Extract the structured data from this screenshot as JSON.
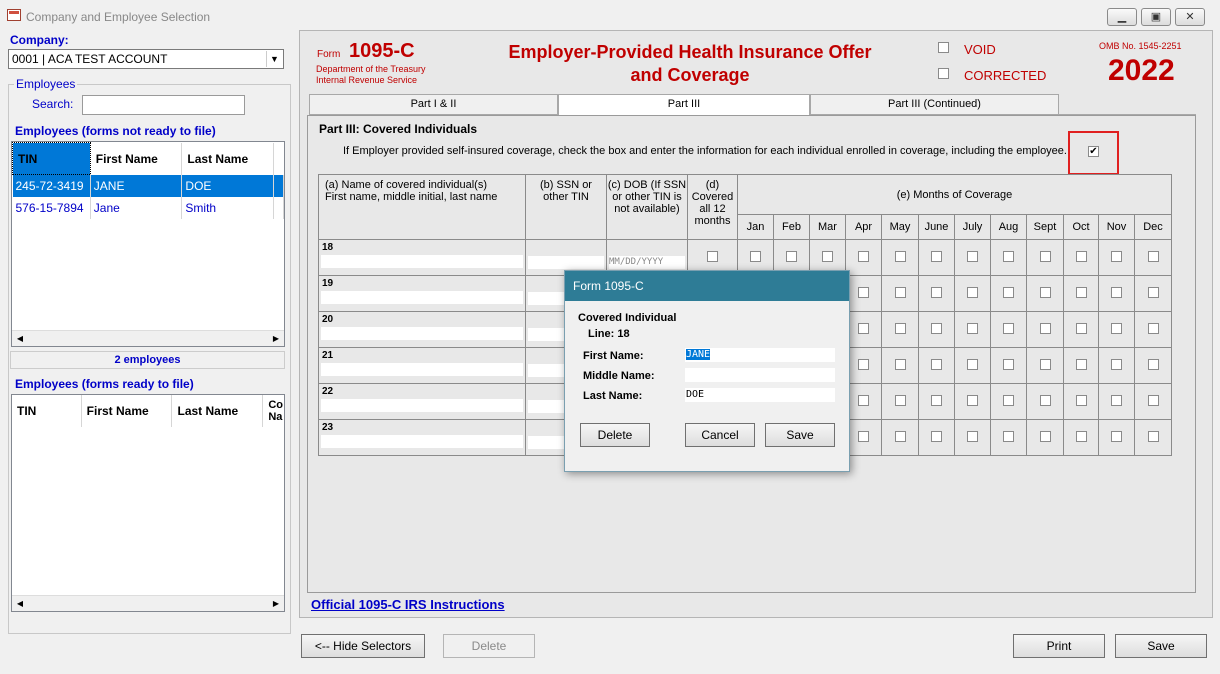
{
  "window": {
    "title": "Company and Employee Selection"
  },
  "left": {
    "company_label": "Company:",
    "company_value": "0001 | ACA TEST ACCOUNT",
    "employees_group": "Employees",
    "search_label": "Search:",
    "search_value": "",
    "not_ready_label": "Employees (forms not ready to file)",
    "grid_headers": [
      "TIN",
      "First Name",
      "Last Name"
    ],
    "employees": [
      {
        "tin": "245-72-3419",
        "first": "JANE",
        "last": "DOE"
      },
      {
        "tin": "576-15-7894",
        "first": "Jane",
        "last": "Smith"
      }
    ],
    "count_text": "2 employees",
    "ready_label": "Employees (forms ready to file)",
    "ready_headers": [
      "TIN",
      "First Name",
      "Last Name",
      "Co",
      "Na"
    ]
  },
  "form": {
    "form_word": "Form",
    "form_number": "1095-C",
    "dept": "Department of the Treasury",
    "irs": "Internal Revenue Service",
    "title_line1": "Employer-Provided Health Insurance Offer",
    "title_line2": "and Coverage",
    "void_label": "VOID",
    "corrected_label": "CORRECTED",
    "omb": "OMB No. 1545-2251",
    "year": "2022",
    "tabs": [
      "Part I & II",
      "Part III",
      "Part III (Continued)"
    ],
    "part_title": "Part III:  Covered Individuals",
    "instruction": "If Employer provided self-insured coverage, check the box and enter the information for each individual enrolled in coverage, including the employee.",
    "self_insured_checked": true,
    "col_a": "(a) Name of covered individual(s)",
    "col_a2": "First name, middle initial, last name",
    "col_b": "(b) SSN or other TIN",
    "col_c": "(c) DOB (If SSN or other TIN is not available)",
    "col_d": "(d) Covered all 12 months",
    "col_e": "(e) Months of Coverage",
    "months": [
      "Jan",
      "Feb",
      "Mar",
      "Apr",
      "May",
      "June",
      "July",
      "Aug",
      "Sept",
      "Oct",
      "Nov",
      "Dec"
    ],
    "lines": [
      "18",
      "19",
      "20",
      "21",
      "22",
      "23"
    ],
    "dob_placeholder": "MM/DD/YYYY",
    "instructions_link": "Official 1095-C IRS Instructions"
  },
  "bottom": {
    "hide_selectors": "<-- Hide Selectors",
    "delete": "Delete",
    "print": "Print",
    "save": "Save"
  },
  "dialog": {
    "title": "Form 1095-C",
    "heading": "Covered Individual",
    "line_label": "Line:  18",
    "first_label": "First Name:",
    "first_value": "JANE",
    "middle_label": "Middle Name:",
    "middle_value": "",
    "last_label": "Last Name:",
    "last_value": "DOE",
    "delete": "Delete",
    "cancel": "Cancel",
    "save": "Save"
  }
}
